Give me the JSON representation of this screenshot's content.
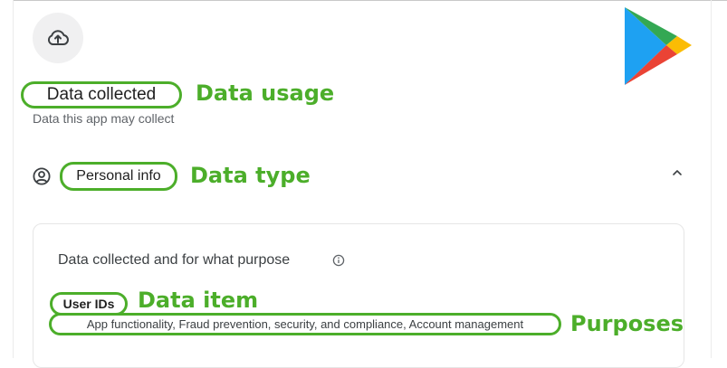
{
  "header": {
    "title": "Data collected",
    "subtitle": "Data this app may collect"
  },
  "section": {
    "label": "Personal info"
  },
  "card": {
    "title": "Data collected and for what purpose",
    "item_name": "User IDs",
    "item_purposes": "App functionality, Fraud prevention, security, and compliance, Account management"
  },
  "annotations": {
    "usage": "Data usage",
    "type": "Data type",
    "item": "Data item",
    "purposes": "Purposes"
  },
  "icons": {
    "upload": "cloud-upload-icon",
    "person": "account-circle-icon",
    "chevron": "chevron-up-icon",
    "info": "info-icon",
    "logo": "google-play-logo"
  },
  "colors": {
    "annotation": "#4cae2a"
  }
}
